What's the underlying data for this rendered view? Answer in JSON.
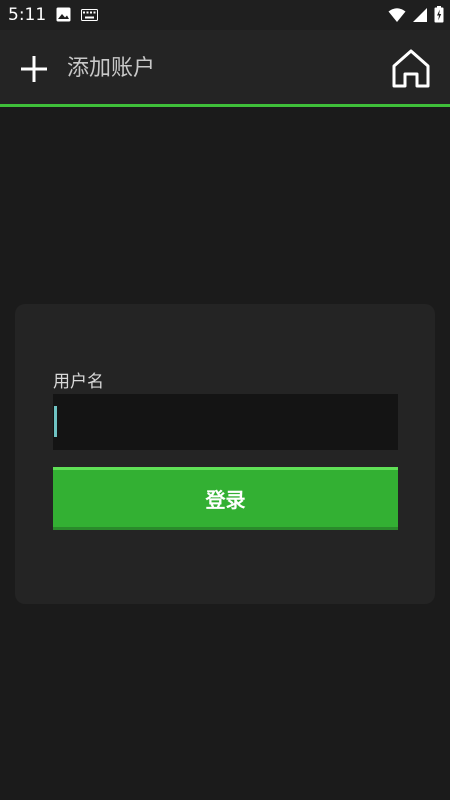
{
  "status_bar": {
    "time": "5:11",
    "left_icons": [
      "image-icon",
      "keyboard-icon"
    ],
    "right_icons": [
      "wifi-icon",
      "signal-icon",
      "battery-icon"
    ]
  },
  "app_bar": {
    "add_icon": "plus-icon",
    "title": "添加账户",
    "home_icon": "home-icon"
  },
  "login_form": {
    "username_label": "用户名",
    "username_value": "",
    "login_label": "登录"
  },
  "colors": {
    "accent_green": "#3fbf3a",
    "button_green": "#33b033",
    "background": "#1b1b1b",
    "surface": "#242424",
    "input_bg": "#141414"
  }
}
